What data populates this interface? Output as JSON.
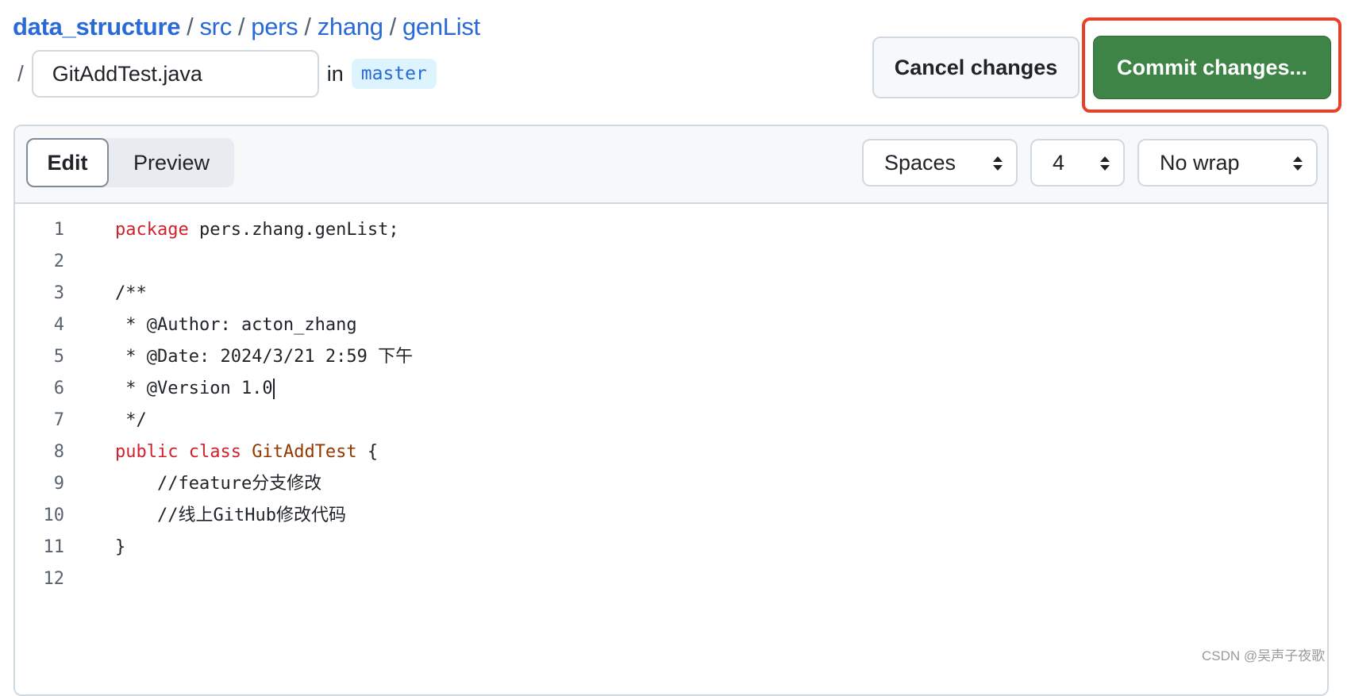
{
  "breadcrumb": {
    "repo": "data_structure",
    "path": [
      "src",
      "pers",
      "zhang",
      "genList"
    ],
    "separator": "/"
  },
  "file": {
    "name": "GitAddTest.java",
    "in_label": "in",
    "branch": "master"
  },
  "actions": {
    "cancel_label": "Cancel changes",
    "commit_label": "Commit changes...",
    "highlight_color": "#e8412a",
    "commit_color": "#3f8447"
  },
  "editor": {
    "tabs": [
      {
        "label": "Edit",
        "active": true
      },
      {
        "label": "Preview",
        "active": false
      }
    ],
    "indent_mode": "Spaces",
    "indent_size": "4",
    "wrap_mode": "No wrap",
    "lines": [
      {
        "n": "1",
        "parts": [
          {
            "t": "package",
            "c": "kw"
          },
          {
            "t": " pers.zhang.genList;",
            "c": ""
          }
        ]
      },
      {
        "n": "2",
        "parts": []
      },
      {
        "n": "3",
        "parts": [
          {
            "t": "/**",
            "c": ""
          }
        ]
      },
      {
        "n": "4",
        "parts": [
          {
            "t": " * @Author: acton_zhang",
            "c": ""
          }
        ]
      },
      {
        "n": "5",
        "parts": [
          {
            "t": " * @Date: 2024/3/21 2:59 下午",
            "c": ""
          }
        ]
      },
      {
        "n": "6",
        "parts": [
          {
            "t": " * @Version 1.0",
            "c": ""
          }
        ],
        "cursor": true
      },
      {
        "n": "7",
        "parts": [
          {
            "t": " */",
            "c": ""
          }
        ]
      },
      {
        "n": "8",
        "parts": [
          {
            "t": "public",
            "c": "kw"
          },
          {
            "t": " ",
            "c": ""
          },
          {
            "t": "class",
            "c": "kw"
          },
          {
            "t": " ",
            "c": ""
          },
          {
            "t": "GitAddTest",
            "c": "cls"
          },
          {
            "t": " {",
            "c": ""
          }
        ]
      },
      {
        "n": "9",
        "parts": [
          {
            "t": "    //feature分支修改",
            "c": ""
          }
        ]
      },
      {
        "n": "10",
        "parts": [
          {
            "t": "    //线上GitHub修改代码",
            "c": ""
          }
        ]
      },
      {
        "n": "11",
        "parts": [
          {
            "t": "}",
            "c": ""
          }
        ]
      },
      {
        "n": "12",
        "parts": []
      }
    ]
  },
  "watermark": "CSDN @吴声子夜歌"
}
